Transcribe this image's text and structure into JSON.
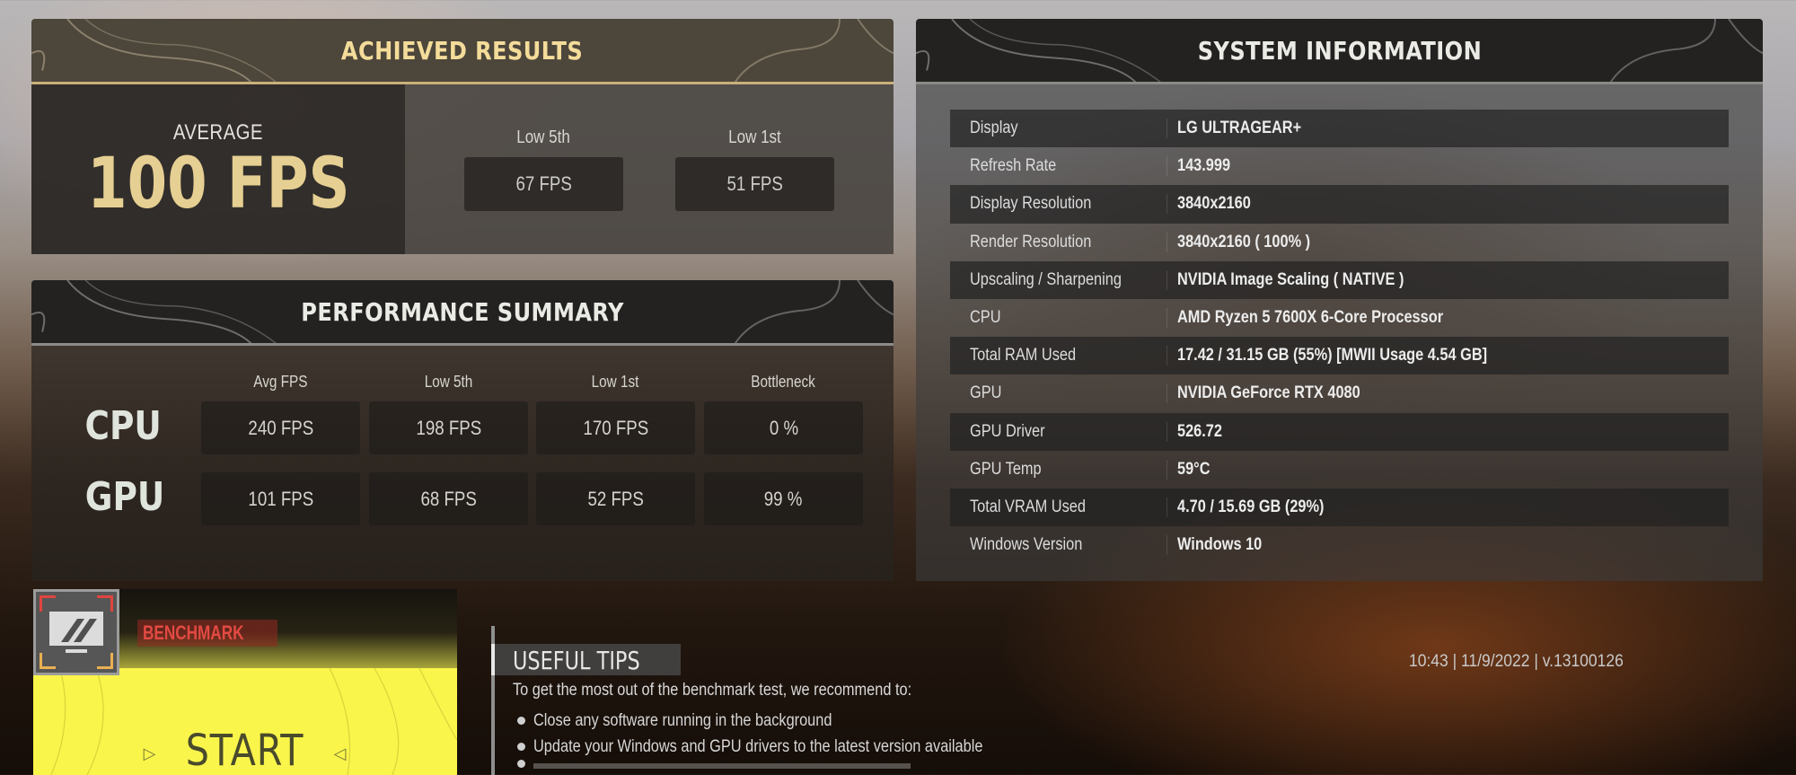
{
  "achieved_results": {
    "title": "ACHIEVED RESULTS",
    "average_label": "AVERAGE",
    "average_value": "100 FPS",
    "low5_label": "Low 5th",
    "low5_value": "67 FPS",
    "low1_label": "Low 1st",
    "low1_value": "51 FPS"
  },
  "performance_summary": {
    "title": "PERFORMANCE SUMMARY",
    "columns": [
      "Avg FPS",
      "Low 5th",
      "Low 1st",
      "Bottleneck"
    ],
    "rows": [
      {
        "label": "CPU",
        "values": [
          "240 FPS",
          "198 FPS",
          "170 FPS",
          "0 %"
        ]
      },
      {
        "label": "GPU",
        "values": [
          "101 FPS",
          "68 FPS",
          "52 FPS",
          "99 %"
        ]
      }
    ]
  },
  "system_information": {
    "title": "SYSTEM INFORMATION",
    "rows": [
      {
        "key": "Display",
        "value": "LG ULTRAGEAR+"
      },
      {
        "key": "Refresh Rate",
        "value": "143.999"
      },
      {
        "key": "Display Resolution",
        "value": "3840x2160"
      },
      {
        "key": "Render Resolution",
        "value": "3840x2160 ( 100% )"
      },
      {
        "key": "Upscaling / Sharpening",
        "value": "NVIDIA Image Scaling ( NATIVE )"
      },
      {
        "key": "CPU",
        "value": "AMD Ryzen 5 7600X 6-Core Processor"
      },
      {
        "key": "Total RAM Used",
        "value": "17.42 / 31.15 GB (55%) [MWII Usage 4.54 GB]"
      },
      {
        "key": "GPU",
        "value": "NVIDIA GeForce RTX 4080"
      },
      {
        "key": "GPU Driver",
        "value": "526.72"
      },
      {
        "key": "GPU Temp",
        "value": "59°C"
      },
      {
        "key": "Total VRAM Used",
        "value": "4.70 / 15.69 GB (29%)"
      },
      {
        "key": "Windows Version",
        "value": "Windows 10"
      }
    ]
  },
  "benchmark": {
    "tag": "BENCHMARK",
    "icon": "monitor-icon",
    "start_label": "START",
    "arrow_left": "▷",
    "arrow_right": "◁"
  },
  "tips": {
    "title": "USEFUL TIPS",
    "intro": "To get the most out of the benchmark test, we recommend to:",
    "items": [
      "Close any software running in the background",
      "Update your Windows and GPU drivers to the latest version available"
    ]
  },
  "footer": {
    "info": "10:43 | 11/9/2022 | v.13100126"
  },
  "colors": {
    "accent_gold": "#f4dc9a",
    "average_gold": "#e6cf92",
    "start_yellow": "#faf54a",
    "benchmark_red": "#e34a42"
  }
}
